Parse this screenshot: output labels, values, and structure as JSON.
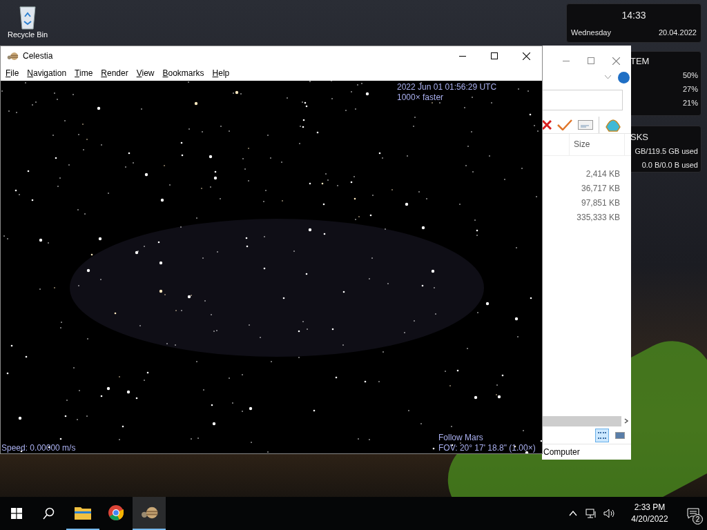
{
  "desktop": {
    "icons": [
      {
        "label": "Recycle Bin"
      }
    ]
  },
  "widgets": {
    "clock": {
      "time": "14:33",
      "day": "Wednesday",
      "date": "20.04.2022"
    },
    "system": {
      "title": "TEM",
      "rows": [
        "50%",
        "27%",
        "21%"
      ]
    },
    "disks": {
      "title": "SKS",
      "rows": [
        "GB/119.5 GB used",
        "0.0 B/0.0 B used"
      ]
    }
  },
  "explorer": {
    "columns": [
      "Size"
    ],
    "sizes": [
      "2,414 KB",
      "36,717 KB",
      "97,851 KB",
      "335,333 KB"
    ],
    "views": [
      {
        "selected": true
      },
      {
        "selected": false
      }
    ],
    "status": "Computer"
  },
  "celestia": {
    "title": "Celestia",
    "menu": [
      "File",
      "Navigation",
      "Time",
      "Render",
      "View",
      "Bookmarks",
      "Help"
    ],
    "time": "2022 Jun 01 01:56:29 UTC",
    "rate": "1000× faster",
    "follow": "Follow Mars",
    "fov": "FOV: 20° 17' 18.8\" (1.00×)",
    "speed": "Speed: 0.00000 m/s"
  },
  "taskbar": {
    "apps": [
      {
        "kind": "explorer",
        "open": true,
        "active": false
      },
      {
        "kind": "chrome",
        "open": false,
        "active": false
      },
      {
        "kind": "celestia",
        "open": true,
        "active": true
      }
    ],
    "time": "2:33 PM",
    "date": "4/20/2022",
    "notifications": "2"
  }
}
